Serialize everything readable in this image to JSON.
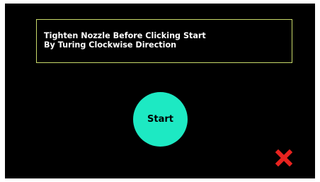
{
  "instruction": {
    "line1": "Tighten Nozzle Before Clicking Start",
    "line2": "By Turing Clockwise Direction"
  },
  "start_button": {
    "label": "Start"
  },
  "icons": {
    "close": "close-icon"
  },
  "colors": {
    "background": "#000000",
    "box_border": "#c8d96a",
    "start_button": "#1de9c3",
    "close_icon": "#e8231f"
  }
}
